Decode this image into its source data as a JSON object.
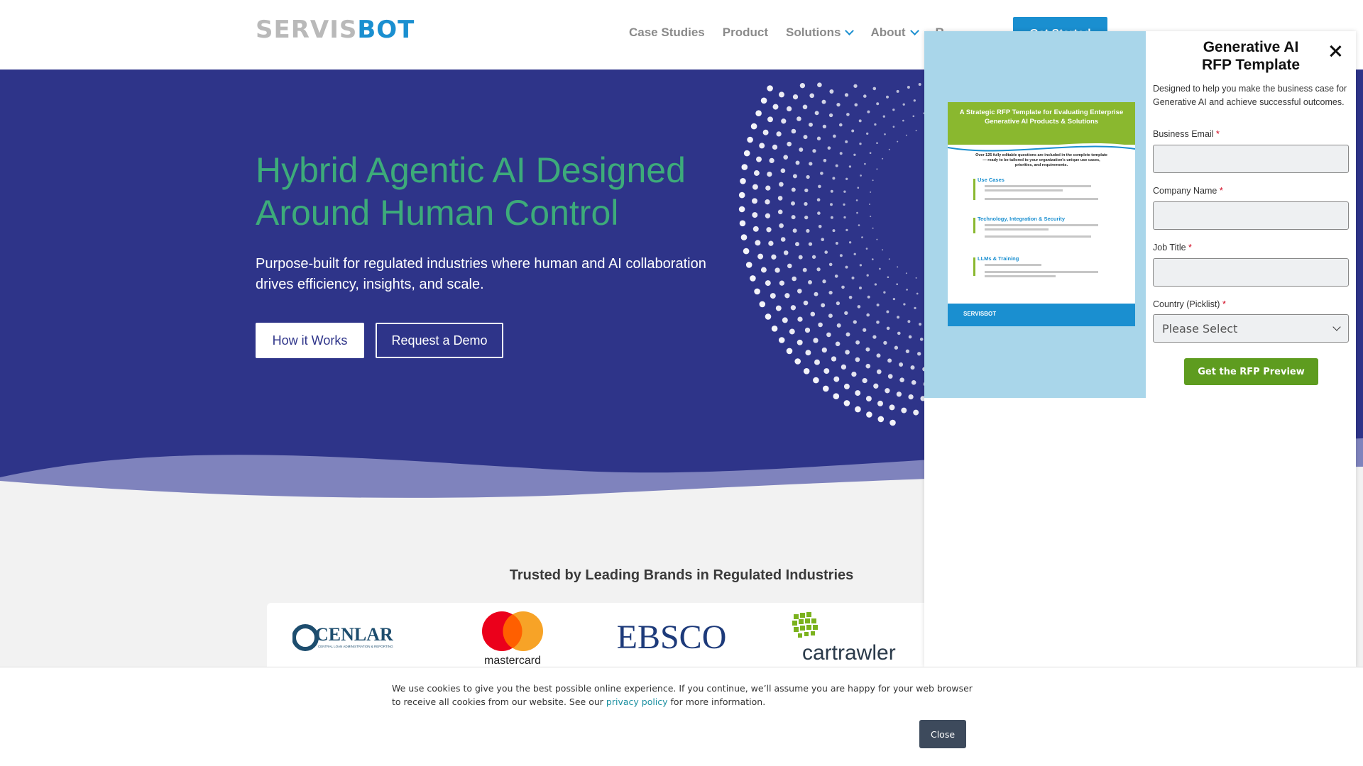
{
  "brand": {
    "logo_left": "SERVIS",
    "logo_right": "BOT"
  },
  "nav": {
    "items": [
      {
        "label": "Case Studies"
      },
      {
        "label": "Product"
      },
      {
        "label": "Solutions"
      },
      {
        "label": "About"
      },
      {
        "label": "R"
      }
    ],
    "cta": "Get Started"
  },
  "hero": {
    "title_line1": "Hybrid Agentic AI Designed",
    "title_line2": "Around Human Control",
    "subtitle_line1": "Purpose-built for regulated industries where human and AI collaboration",
    "subtitle_line2": "drives efficiency, insights, and scale.",
    "btn_how": "How it Works",
    "btn_demo": "Request a Demo"
  },
  "trusted": {
    "heading": "Trusted by Leading Brands in Regulated Industries",
    "logos": [
      "CENLAR",
      "mastercard",
      "EBSCO",
      "cartrawler"
    ],
    "cenlar_tagline": "CENTRAL LOAN ADMINISTRATION & REPORTING"
  },
  "modal": {
    "doc_title": "A Strategic RFP Template for Evaluating Enterprise Generative AI Products & Solutions",
    "doc_intro": "Over 125 fully editable questions are included in the complete template — ready to be tailored to your organization's unique use cases, priorities, and requirements.",
    "doc_sections": [
      "Use Cases",
      "Technology, Integration & Security",
      "LLMs & Training"
    ],
    "doc_footer_logo": "SERVISBOT",
    "title_line1": "Generative AI",
    "title_line2": "RFP Template",
    "description": "Designed to help you make the business case for Generative AI and achieve successful outcomes.",
    "fields": {
      "email_label": "Business Email",
      "company_label": "Company Name",
      "job_label": "Job Title",
      "country_label": "Country (Picklist)",
      "country_value": "Please Select"
    },
    "required_mark": "*",
    "submit": "Get the RFP Preview"
  },
  "cookie": {
    "text_before": "We use cookies to give you the best possible online experience. If you continue, we’ll assume you are happy for your web browser to receive all cookies from our website. See our ",
    "link": "privacy policy",
    "text_after": " for more information.",
    "close": "Close"
  },
  "colors": {
    "hero_bg": "#2e3489",
    "hero_title": "#3dab7a",
    "brand_blue": "#1a8fd0",
    "rfp_green": "#5e9c1f"
  }
}
